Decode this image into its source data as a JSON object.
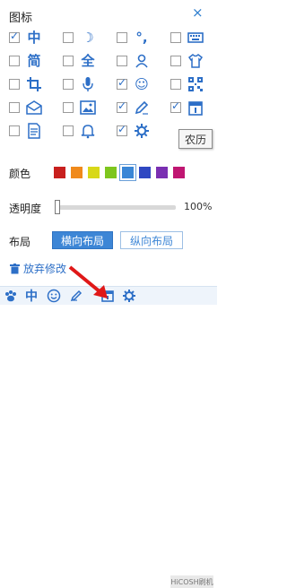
{
  "panel": {
    "title": "图标",
    "close_glyph": "×",
    "tooltip": "农历"
  },
  "icons": [
    {
      "name": "chinese-char-zhong",
      "glyph": "中",
      "checked": true
    },
    {
      "name": "moon-icon",
      "glyph": "☽",
      "checked": false
    },
    {
      "name": "punctuation-icon",
      "glyph": "°,",
      "checked": false
    },
    {
      "name": "keyboard-icon",
      "glyph": "",
      "checked": false
    },
    {
      "name": "simplified-char-jian",
      "glyph": "简",
      "checked": false
    },
    {
      "name": "full-width-char-quan",
      "glyph": "全",
      "checked": false
    },
    {
      "name": "user-icon",
      "glyph": "",
      "checked": false
    },
    {
      "name": "tshirt-icon",
      "glyph": "",
      "checked": false
    },
    {
      "name": "crop-icon",
      "glyph": "",
      "checked": false
    },
    {
      "name": "microphone-icon",
      "glyph": "",
      "checked": false
    },
    {
      "name": "smiley-icon",
      "glyph": "☺",
      "checked": true
    },
    {
      "name": "qr-code-icon",
      "glyph": "",
      "checked": false
    },
    {
      "name": "mail-icon",
      "glyph": "",
      "checked": false
    },
    {
      "name": "image-icon",
      "glyph": "",
      "checked": false
    },
    {
      "name": "pencil-icon",
      "glyph": "",
      "checked": true
    },
    {
      "name": "calendar-icon",
      "glyph": "",
      "checked": true
    },
    {
      "name": "document-icon",
      "glyph": "",
      "checked": false
    },
    {
      "name": "bell-icon",
      "glyph": "",
      "checked": false
    },
    {
      "name": "gear-icon",
      "glyph": "",
      "checked": true
    }
  ],
  "color": {
    "label": "颜色",
    "swatches": [
      "#c8201e",
      "#f08a1c",
      "#d8d818",
      "#7ec61e",
      "#3a86d6",
      "#2f48c2",
      "#7a2fb2",
      "#c01672"
    ],
    "selected_index": 4
  },
  "opacity": {
    "label": "透明度",
    "value_text": "100%",
    "value_fraction": 1.0
  },
  "layout": {
    "label": "布局",
    "horizontal_label": "横向布局",
    "vertical_label": "纵向布局",
    "selected": "horizontal"
  },
  "discard": {
    "label": "放弃修改"
  },
  "toolbar": {
    "items": [
      "paw-icon",
      "中",
      "smiley-icon",
      "pencil-icon",
      "calendar-icon",
      "gear-icon"
    ],
    "watermark": "HiCOSH刷机"
  }
}
